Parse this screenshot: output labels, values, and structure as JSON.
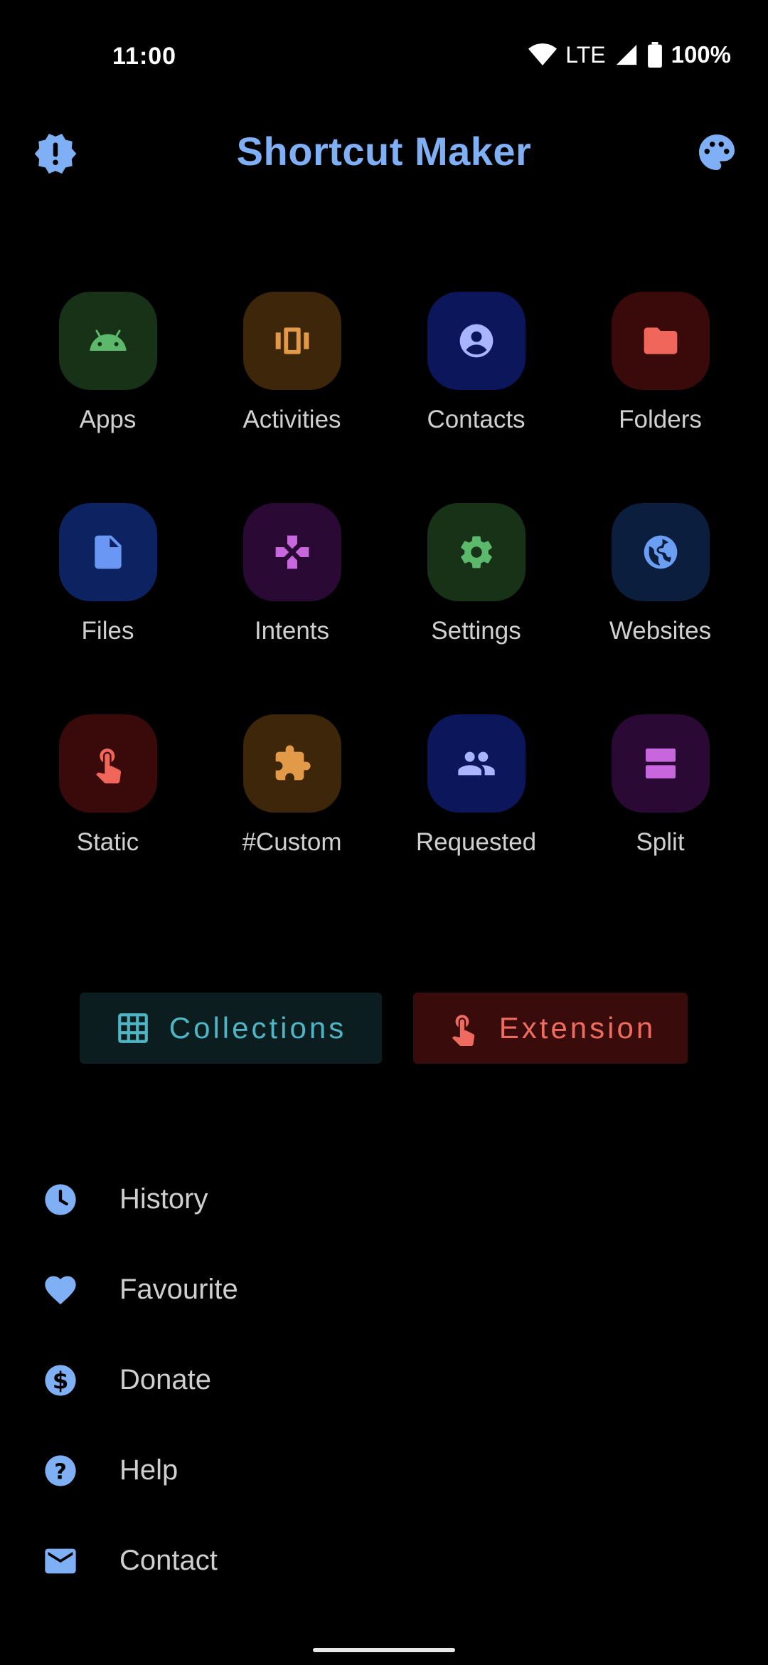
{
  "status_bar": {
    "time": "11:00",
    "network": "LTE",
    "battery": "100%"
  },
  "app_bar": {
    "title": "Shortcut Maker",
    "left_icon": "alert-badge-icon",
    "right_icon": "palette-icon",
    "accent": "#7fb0f5"
  },
  "grid": {
    "items": [
      {
        "label": "Apps",
        "icon": "android-icon",
        "bg": "#173217",
        "fg": "#5cb86a"
      },
      {
        "label": "Activities",
        "icon": "carousel-icon",
        "bg": "#3d2609",
        "fg": "#e39a48"
      },
      {
        "label": "Contacts",
        "icon": "account-circle-icon",
        "bg": "#0c165a",
        "fg": "#a9b5ff"
      },
      {
        "label": "Folders",
        "icon": "folder-icon",
        "bg": "#3a0a0a",
        "fg": "#f0665a"
      },
      {
        "label": "Files",
        "icon": "file-icon",
        "bg": "#0d2260",
        "fg": "#6a97f3"
      },
      {
        "label": "Intents",
        "icon": "intent-icon",
        "bg": "#2a0a34",
        "fg": "#c866dd"
      },
      {
        "label": "Settings",
        "icon": "gear-icon",
        "bg": "#173217",
        "fg": "#5cb86a"
      },
      {
        "label": "Websites",
        "icon": "globe-icon",
        "bg": "#0c1e3d",
        "fg": "#6a9ff3"
      },
      {
        "label": "Static",
        "icon": "touch-icon",
        "bg": "#3a0a0a",
        "fg": "#f0665a"
      },
      {
        "label": "#Custom",
        "icon": "puzzle-icon",
        "bg": "#3d2609",
        "fg": "#e39a48"
      },
      {
        "label": "Requested",
        "icon": "people-icon",
        "bg": "#0c165a",
        "fg": "#a9b5ff"
      },
      {
        "label": "Split",
        "icon": "split-icon",
        "bg": "#2a0a34",
        "fg": "#c866dd"
      }
    ]
  },
  "buttons": {
    "collections": {
      "label": "Collections",
      "icon": "grid-icon",
      "color": "#4fb4c4"
    },
    "extension": {
      "label": "Extension",
      "icon": "touch-icon",
      "color": "#f06b5f"
    }
  },
  "menu": {
    "items": [
      {
        "label": "History",
        "icon": "clock-icon"
      },
      {
        "label": "Favourite",
        "icon": "heart-icon"
      },
      {
        "label": "Donate",
        "icon": "dollar-icon"
      },
      {
        "label": "Help",
        "icon": "help-icon"
      },
      {
        "label": "Contact",
        "icon": "mail-icon"
      }
    ]
  }
}
